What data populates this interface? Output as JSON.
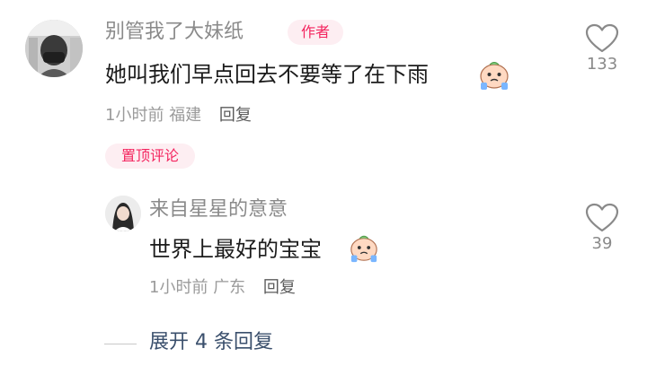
{
  "comment": {
    "author": "别管我了大妹纸",
    "author_badge": "作者",
    "text": "她叫我们早点回去不要等了在下雨",
    "emoji": "crying-face-sticker",
    "time": "1小时前",
    "location": "福建",
    "reply_label": "回复",
    "pinned_label": "置顶评论",
    "like_count": "133"
  },
  "reply": {
    "author": "来自星星的意意",
    "text": "世界上最好的宝宝",
    "emoji": "crying-face-sticker",
    "time": "1小时前",
    "location": "广东",
    "reply_label": "回复",
    "like_count": "39"
  },
  "expand_replies_label": "展开 4 条回复",
  "colors": {
    "accent": "#f4255f",
    "badge_bg": "#fdeef2",
    "link": "#3a4f6c",
    "muted": "#9b9b9b",
    "text": "#1b1b1b"
  }
}
